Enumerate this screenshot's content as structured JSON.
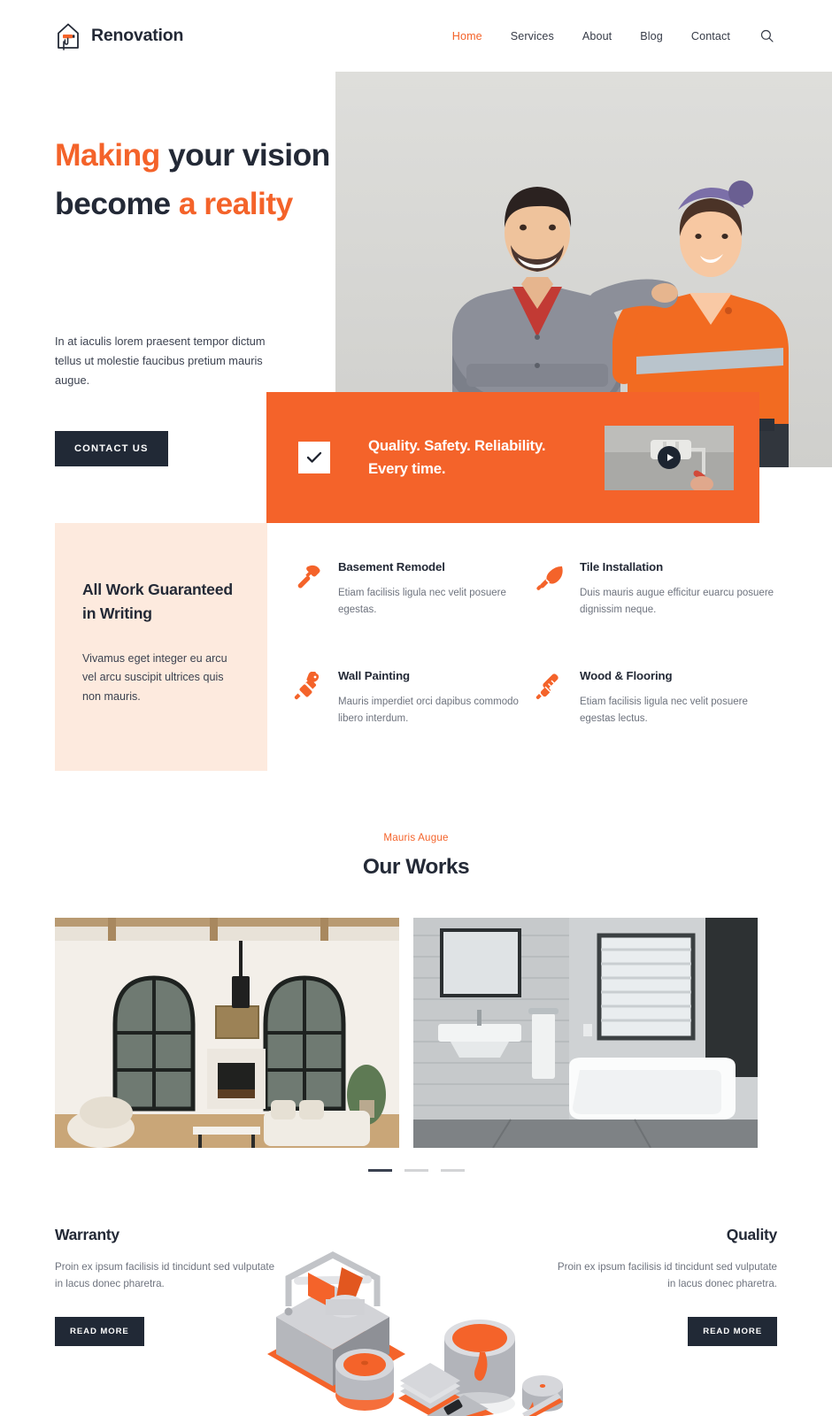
{
  "header": {
    "brand": "Renovation",
    "logo_icon": "house-paint-roller-icon",
    "nav": [
      {
        "label": "Home",
        "active": true
      },
      {
        "label": "Services",
        "active": false
      },
      {
        "label": "About",
        "active": false
      },
      {
        "label": "Blog",
        "active": false
      },
      {
        "label": "Contact",
        "active": false
      }
    ],
    "search_icon": "search-icon"
  },
  "hero": {
    "title_line1_a": "Making",
    "title_line1_b": " your vision",
    "title_line2_a": "become ",
    "title_line2_b": "a reality",
    "paragraph": "In at iaculis lorem praesent tempor dictum tellus ut molestie faucibus pretium mauris augue.",
    "cta_label": "CONTACT US",
    "photo_alt": "two-renovation-workers-photo"
  },
  "banner": {
    "check_icon": "check-icon",
    "line1": "Quality. Safety. Reliability.",
    "line2": "Every time.",
    "video_thumb_alt": "paint-roller-video-thumbnail",
    "play_icon": "play-icon"
  },
  "guarantee": {
    "title": "All Work Guaranteed in Writing",
    "text": "Vivamus eget integer eu arcu vel arcu suscipit ultrices quis non mauris."
  },
  "services": [
    {
      "icon": "hammer-icon",
      "title": "Basement Remodel",
      "desc": "Etiam facilisis ligula nec velit posuere egestas."
    },
    {
      "icon": "trowel-icon",
      "title": "Tile Installation",
      "desc": "Duis mauris augue efficitur euarcu posuere dignissim neque."
    },
    {
      "icon": "paintbrush-icon",
      "title": "Wall Painting",
      "desc": "Mauris imperdiet orci dapibus commodo libero interdum."
    },
    {
      "icon": "chisel-icon",
      "title": "Wood & Flooring",
      "desc": "Etiam facilisis ligula nec velit posuere egestas lectus."
    }
  ],
  "works": {
    "eyebrow": "Mauris Augue",
    "title": "Our Works",
    "images": [
      {
        "alt": "living-room-with-arched-windows-photo"
      },
      {
        "alt": "bathroom-with-freestanding-tub-photo"
      }
    ],
    "carousel_dots": [
      {
        "active": true
      },
      {
        "active": false
      },
      {
        "active": false
      }
    ]
  },
  "warranty": {
    "title": "Warranty",
    "text": "Proin ex ipsum facilisis id tincidunt sed vulputate in lacus donec pharetra.",
    "button": "READ MORE"
  },
  "quality": {
    "title": "Quality",
    "text": "Proin ex ipsum facilisis id tincidunt sed vulputate in lacus donec pharetra.",
    "button": "READ MORE"
  },
  "illustration": {
    "alt": "isometric-toolbox-paint-cans-illustration"
  },
  "colors": {
    "accent": "#f4632a",
    "dark": "#212936",
    "cream": "#fdeade",
    "muted": "#6e737e"
  }
}
